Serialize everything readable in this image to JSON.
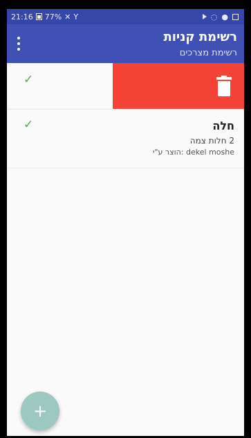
{
  "status_bar": {
    "time": "21:16",
    "battery": "77%"
  },
  "app_bar": {
    "title": "רשימת קניות",
    "subtitle": "רשימת מצרכים"
  },
  "items": [
    {
      "state": "swiped",
      "check": "✓",
      "delete_icon": "trash-icon"
    },
    {
      "check": "✓",
      "title": "חלה",
      "quantity": "2 חלות צמה",
      "added_by": "הוצר ע\"י: dekel moshe"
    }
  ],
  "fab": {
    "label": "+"
  },
  "colors": {
    "primary": "#3f51b5",
    "status_bar": "#3548a8",
    "delete": "#f44336",
    "check": "#4caf50",
    "fab": "#9dc8c0"
  }
}
